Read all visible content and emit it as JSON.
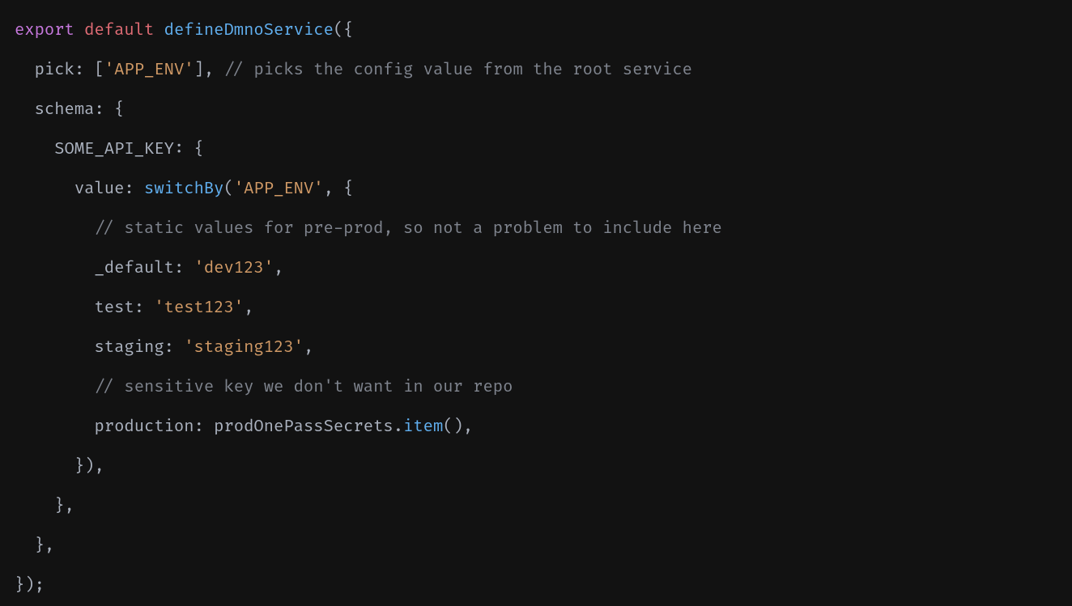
{
  "code": {
    "line1": {
      "export": "export",
      "default": "default",
      "fn": "defineDmnoService",
      "open": "({"
    },
    "line2": {
      "prop": "pick",
      "colon": ": [",
      "str": "'APP_ENV'",
      "close": "], ",
      "comment": "// picks the config value from the root service"
    },
    "line3": {
      "prop": "schema",
      "rest": ": {"
    },
    "line4": {
      "prop": "SOME_API_KEY",
      "rest": ": {"
    },
    "line5": {
      "prop": "value",
      "colon": ": ",
      "fn": "switchBy",
      "open": "(",
      "str": "'APP_ENV'",
      "rest": ", {"
    },
    "line6": {
      "comment": "// static values for pre-prod, so not a problem to include here"
    },
    "line7": {
      "prop": "_default",
      "colon": ": ",
      "str": "'dev123'",
      "comma": ","
    },
    "line8": {
      "prop": "test",
      "colon": ": ",
      "str": "'test123'",
      "comma": ","
    },
    "line9": {
      "prop": "staging",
      "colon": ": ",
      "str": "'staging123'",
      "comma": ","
    },
    "line10": {
      "comment": "// sensitive key we don't want in our repo"
    },
    "line11": {
      "prop": "production",
      "colon": ": prodOnePassSecrets",
      "dot": ".",
      "method": "item",
      "rest": "(),"
    },
    "line12": {
      "text": "}),"
    },
    "line13": {
      "text": "},"
    },
    "line14": {
      "text": "},"
    },
    "line15": {
      "text": "});"
    }
  }
}
